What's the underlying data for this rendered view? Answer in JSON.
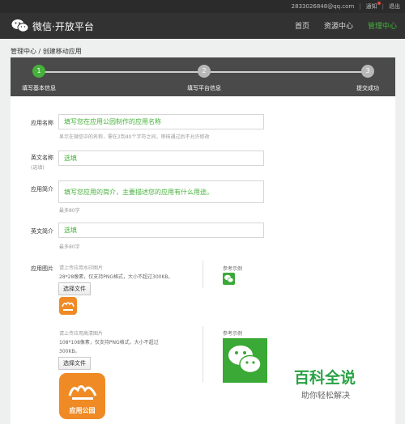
{
  "topbar": {
    "email": "2833026848@qq.com",
    "notice": "通知",
    "logout": "退出"
  },
  "header": {
    "title": "微信·开放平台",
    "nav": [
      "首页",
      "资源中心",
      "管理中心"
    ],
    "active_nav": "管理中心"
  },
  "breadcrumb": "管理中心 / 创建移动应用",
  "steps": [
    {
      "num": "1",
      "label": "填写基本信息",
      "active": true
    },
    {
      "num": "2",
      "label": "填写平台信息",
      "active": false
    },
    {
      "num": "3",
      "label": "提交成功",
      "active": false
    }
  ],
  "form": {
    "app_name": {
      "label": "应用名称",
      "value": "填写您在应用公园制作的应用名称",
      "hint": "显示在微信中的名称，需在2到40个字符之间，审核通过后不允许修改"
    },
    "en_name": {
      "label": "英文名称",
      "sublabel": "(选填)",
      "value": "选填"
    },
    "intro": {
      "label": "应用简介",
      "value": "填写您应用的简介，主要描述您的应用有什么用途。",
      "hint": "最多80字"
    },
    "en_intro": {
      "label": "英文简介",
      "value": "选填",
      "hint": "最多80字"
    },
    "app_image": {
      "label": "应用图片",
      "small": {
        "desc1": "请上传应用水印图片",
        "desc2": "28*28像素，仅支持PNG格式，大小不超过300KB。",
        "button": "选择文件",
        "example": "参考示例"
      },
      "large": {
        "desc1": "请上传应用高清图片",
        "desc2": "108*108像素，仅支持PNG格式，大小不超过",
        "desc3": "300KB。",
        "button": "选择文件",
        "example": "参考示例",
        "logo_text": "应用公园"
      }
    }
  },
  "watermark": {
    "title": "百科全说",
    "subtitle": "助你轻松解决"
  },
  "colors": {
    "accent": "#46b23b",
    "nav_bg": "#323232",
    "orange": "#f08a24"
  }
}
